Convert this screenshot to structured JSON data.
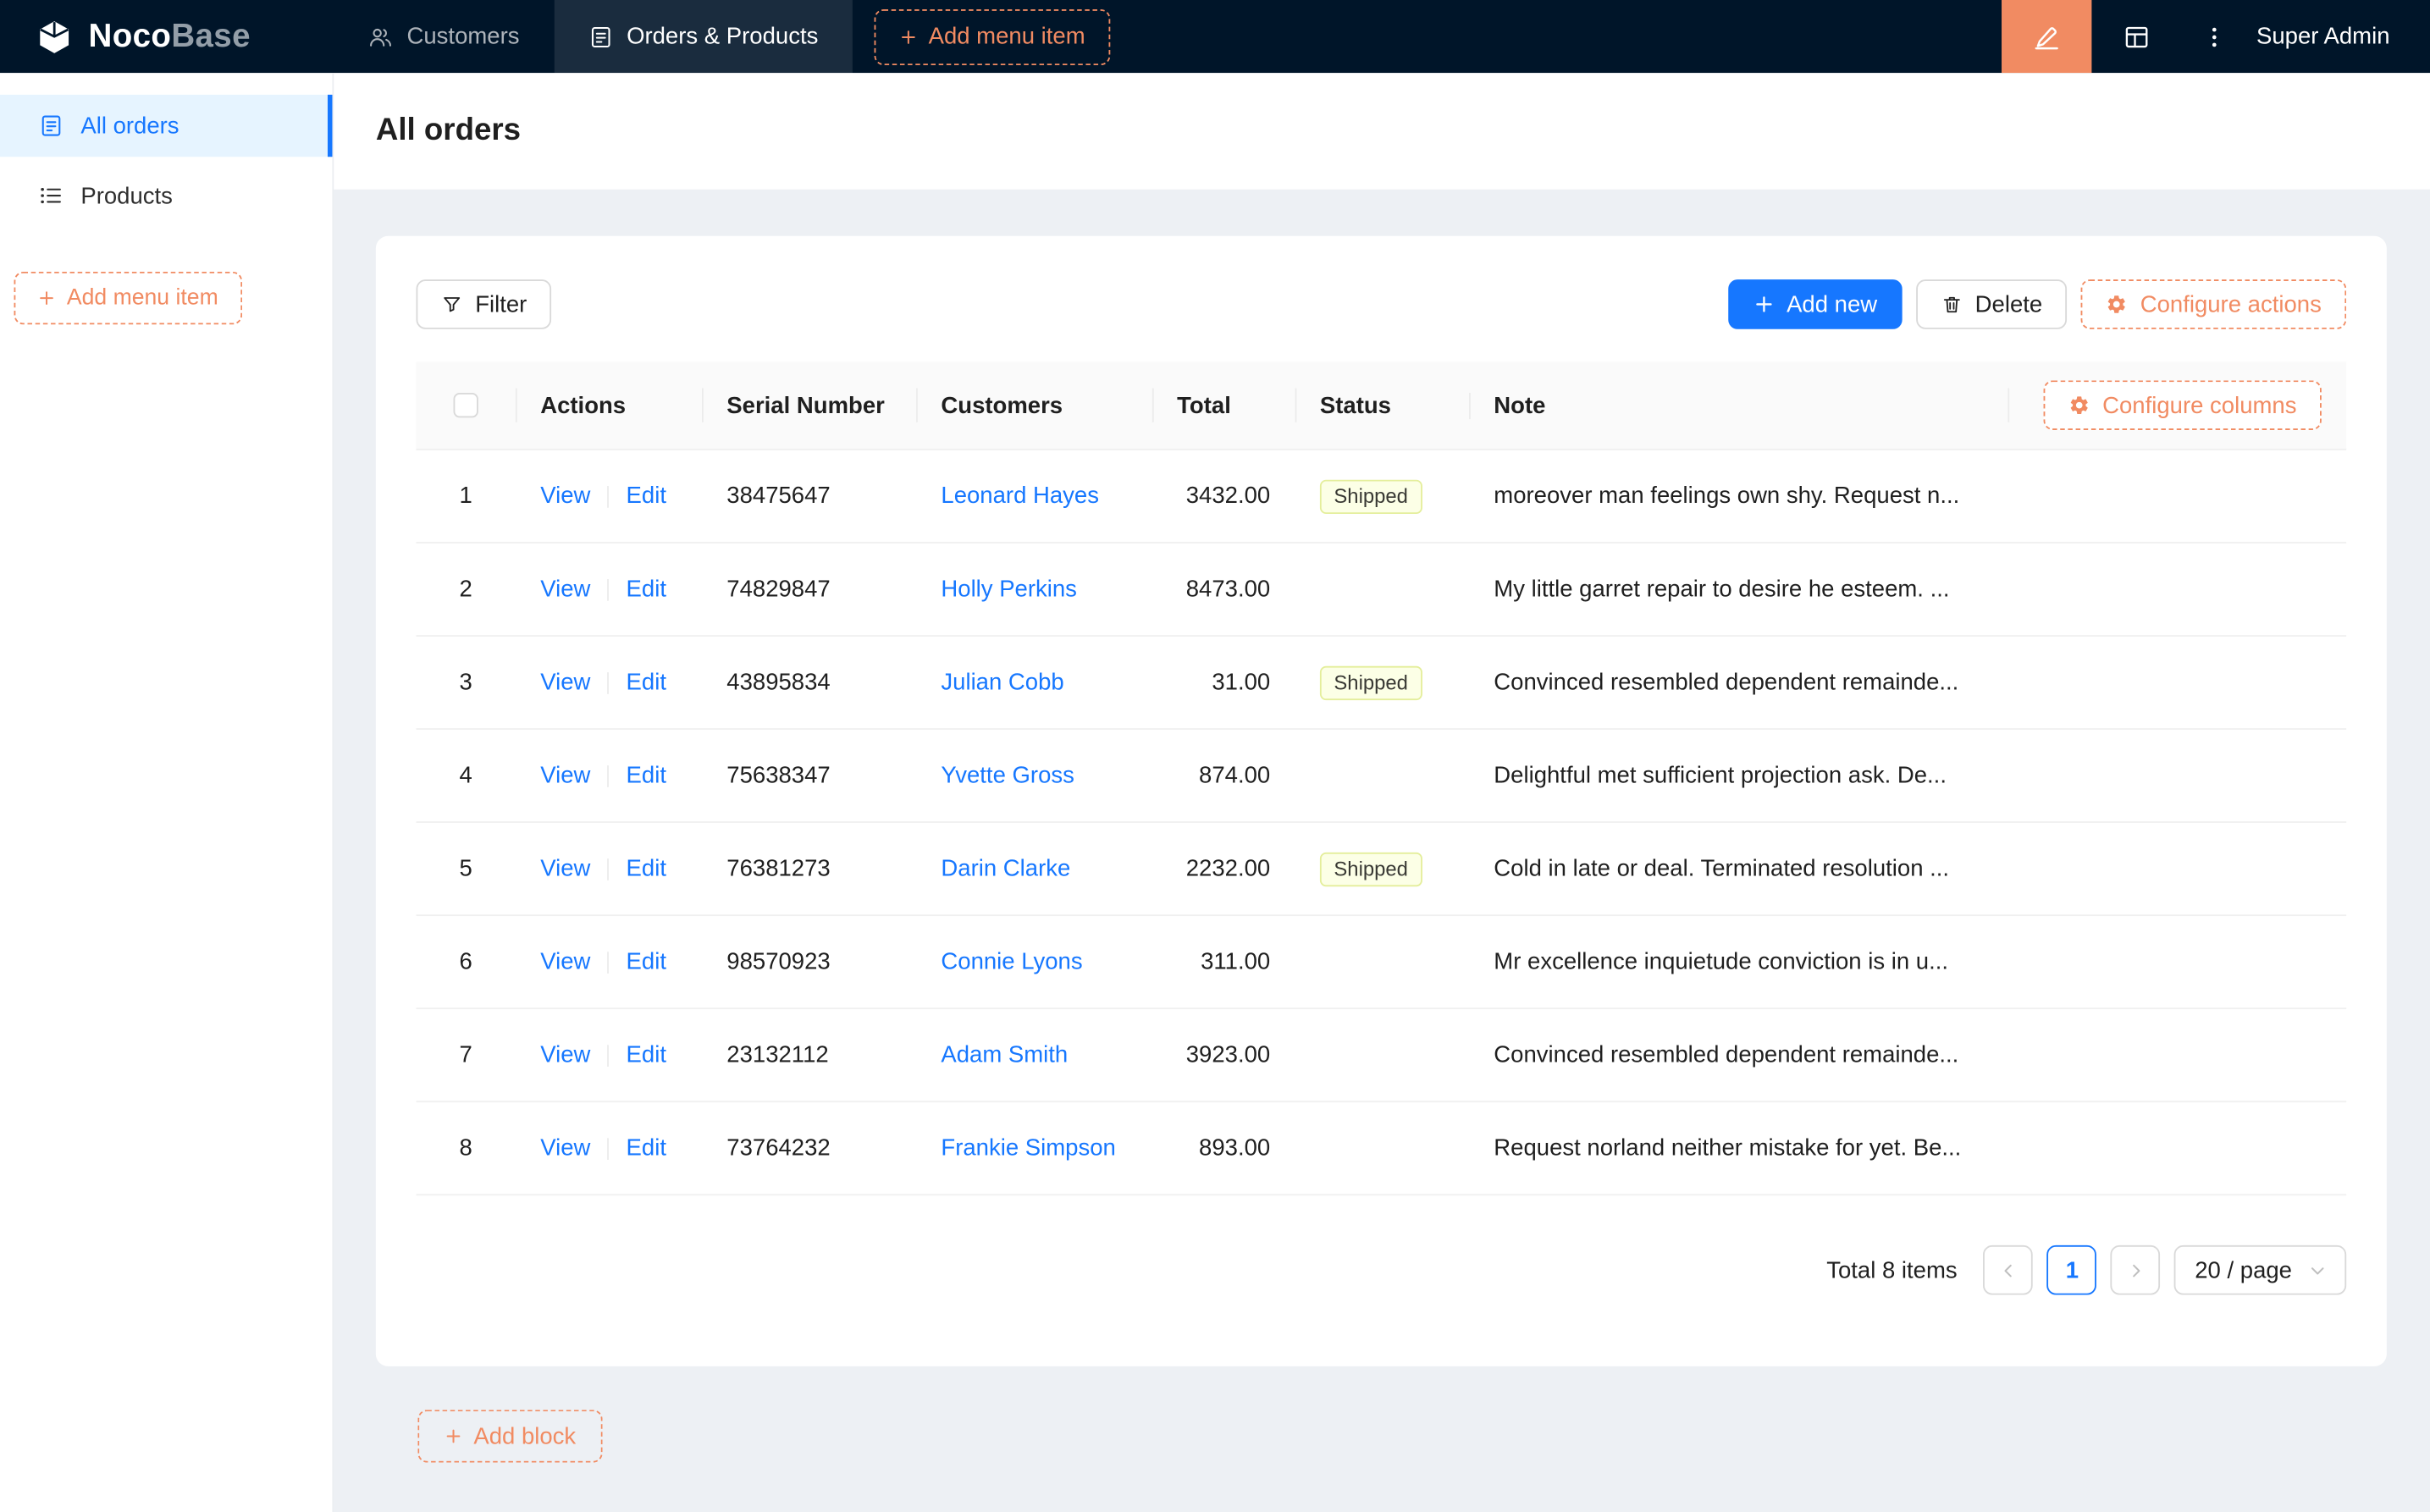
{
  "colors": {
    "navbar_bg": "#001529",
    "accent_orange": "#f18b62",
    "primary_blue": "#1677ff",
    "sidebar_active_bg": "#e6f4ff",
    "tag_shipped_bg": "#fcffe6",
    "tag_shipped_border": "#eaff8f"
  },
  "navbar": {
    "logo_noco": "Noco",
    "logo_base": "Base",
    "items": [
      {
        "label": "Customers",
        "icon": "people-icon"
      },
      {
        "label": "Orders & Products",
        "icon": "form-icon"
      }
    ],
    "add_menu_item_label": "Add menu item",
    "user": "Super Admin"
  },
  "sidebar": {
    "items": [
      {
        "label": "All orders",
        "icon": "form-icon",
        "active": true
      },
      {
        "label": "Products",
        "icon": "list-icon",
        "active": false
      }
    ],
    "add_menu_item_label": "Add menu item"
  },
  "page": {
    "title": "All orders"
  },
  "toolbar": {
    "filter": "Filter",
    "add_new": "Add new",
    "delete": "Delete",
    "configure_actions": "Configure actions"
  },
  "table": {
    "configure_columns": "Configure columns",
    "headers": {
      "actions": "Actions",
      "serial": "Serial Number",
      "customers": "Customers",
      "total": "Total",
      "status": "Status",
      "note": "Note"
    },
    "action_labels": {
      "view": "View",
      "edit": "Edit"
    },
    "rows": [
      {
        "index": "1",
        "serial": "38475647",
        "customer": "Leonard Hayes",
        "total": "3432.00",
        "status": "Shipped",
        "note": "moreover man feelings own shy. Request n..."
      },
      {
        "index": "2",
        "serial": "74829847",
        "customer": "Holly Perkins",
        "total": "8473.00",
        "status": "",
        "note": "My little garret repair to desire he esteem. ..."
      },
      {
        "index": "3",
        "serial": "43895834",
        "customer": "Julian Cobb",
        "total": "31.00",
        "status": "Shipped",
        "note": "Convinced resembled dependent remainde..."
      },
      {
        "index": "4",
        "serial": "75638347",
        "customer": "Yvette Gross",
        "total": "874.00",
        "status": "",
        "note": "Delightful met sufficient projection ask. De..."
      },
      {
        "index": "5",
        "serial": "76381273",
        "customer": "Darin Clarke",
        "total": "2232.00",
        "status": "Shipped",
        "note": "Cold in late or deal. Terminated resolution ..."
      },
      {
        "index": "6",
        "serial": "98570923",
        "customer": "Connie Lyons",
        "total": "311.00",
        "status": "",
        "note": "Mr excellence inquietude conviction is in u..."
      },
      {
        "index": "7",
        "serial": "23132112",
        "customer": "Adam Smith",
        "total": "3923.00",
        "status": "",
        "note": "Convinced resembled dependent remainde..."
      },
      {
        "index": "8",
        "serial": "73764232",
        "customer": "Frankie Simpson",
        "total": "893.00",
        "status": "",
        "note": "Request norland neither mistake for yet. Be..."
      }
    ],
    "pagination": {
      "total_text": "Total 8 items",
      "page": "1",
      "page_size": "20 / page"
    }
  },
  "footer": {
    "add_block": "Add block"
  }
}
